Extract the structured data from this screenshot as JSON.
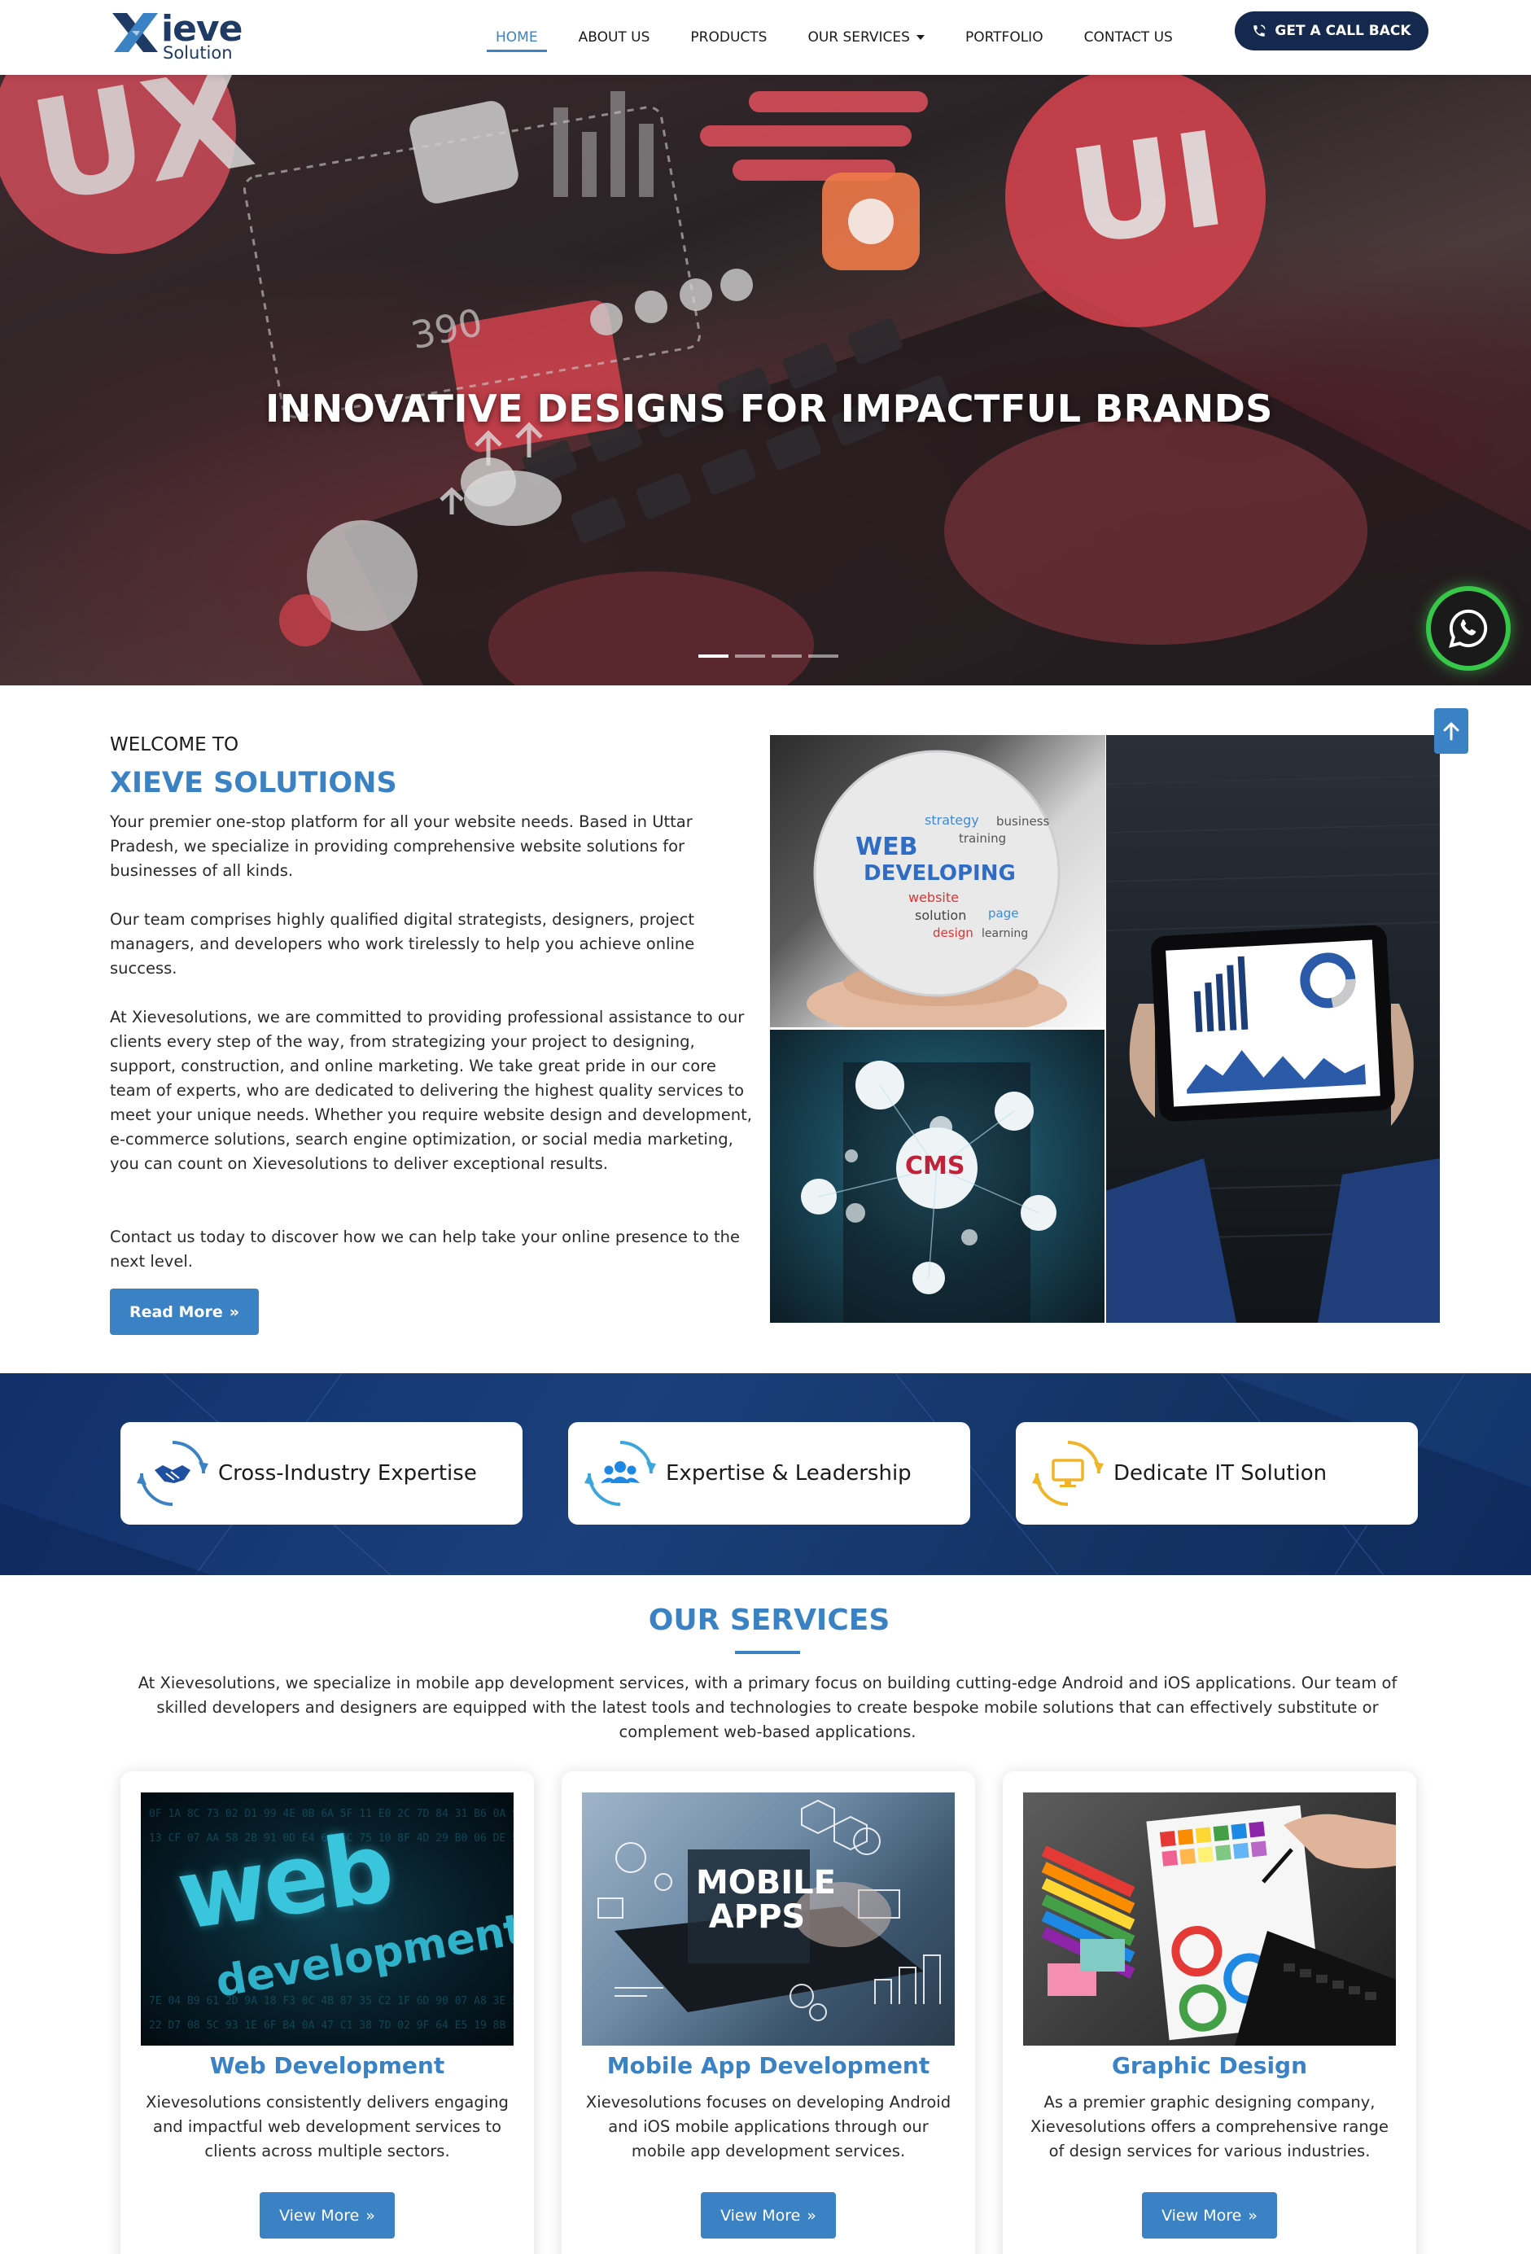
{
  "brand": {
    "logo_main": "ieve",
    "logo_sub": "Solution",
    "primary_color": "#3b82c4",
    "navy_color": "#15294f"
  },
  "nav": {
    "items": [
      {
        "label": "HOME",
        "active": true
      },
      {
        "label": "ABOUT US",
        "active": false
      },
      {
        "label": "PRODUCTS",
        "active": false
      },
      {
        "label": "OUR SERVICES",
        "active": false,
        "dropdown": true
      },
      {
        "label": "PORTFOLIO",
        "active": false
      },
      {
        "label": "CONTACT US",
        "active": false
      }
    ],
    "cta_label": "GET A CALL BACK",
    "cta_icon": "phone-icon"
  },
  "hero": {
    "title": "INNOVATIVE DESIGNS FOR IMPACTFUL BRANDS",
    "decor_text_ux": "UX",
    "decor_text_ui": "UI",
    "decor_number": "390",
    "slides_count": 4,
    "active_slide": 1
  },
  "welcome": {
    "pre_title": "WELCOME TO",
    "title": "XIEVE SOLUTIONS",
    "paragraphs": [
      "Your premier one-stop platform for all your website needs. Based in Uttar Pradesh, we specialize in providing comprehensive website solutions for businesses of all kinds.",
      "Our team comprises highly qualified digital strategists, designers, project managers, and developers who work tirelessly to help you achieve online success.",
      "At Xievesolutions, we are committed to providing professional assistance to our clients every step of the way, from strategizing your project to designing, support, construction, and online marketing. We take great pride in our core team of experts, who are dedicated to delivering the highest quality services to meet your unique needs. Whether you require website design and development, e-commerce solutions, search engine optimization, or social media marketing, you can count on Xievesolutions to deliver exceptional results.",
      "Contact us today to discover how we can help take your online presence to the next level."
    ],
    "read_more_label": "Read More",
    "images": {
      "globe_words": [
        "WEB",
        "DEVELOPING",
        "strategy",
        "training",
        "website",
        "solution",
        "design",
        "page",
        "business",
        "learning"
      ],
      "cms_label": "CMS"
    }
  },
  "features": [
    {
      "label": "Cross-Industry Expertise",
      "icon": "handshake-icon",
      "color": "#3b82c4"
    },
    {
      "label": "Expertise & Leadership",
      "icon": "users-icon",
      "color": "#3aa6dc"
    },
    {
      "label": "Dedicate IT Solution",
      "icon": "monitor-icon",
      "color": "#f0b429"
    }
  ],
  "services": {
    "title": "OUR SERVICES",
    "description": "At Xievesolutions, we specialize in mobile app development services, with a primary focus on building cutting-edge Android and iOS applications. Our team of skilled developers and designers are equipped with the latest tools and technologies to create bespoke mobile solutions that can effectively substitute or complement web-based applications.",
    "cards": [
      {
        "title": "Web Development",
        "description": "Xievesolutions consistently delivers engaging and impactful web development services to clients across multiple sectors.",
        "button": "View More",
        "image_text_1": "web",
        "image_text_2": "development"
      },
      {
        "title": "Mobile App Development",
        "description": "Xievesolutions focuses on developing Android and iOS mobile applications through our mobile app development services.",
        "button": "View More",
        "image_text_1": "MOBILE",
        "image_text_2": "APPS"
      },
      {
        "title": "Graphic Design",
        "description": "As a premier graphic designing company, Xievesolutions offers a comprehensive range of design services for various industries.",
        "button": "View More"
      }
    ]
  }
}
